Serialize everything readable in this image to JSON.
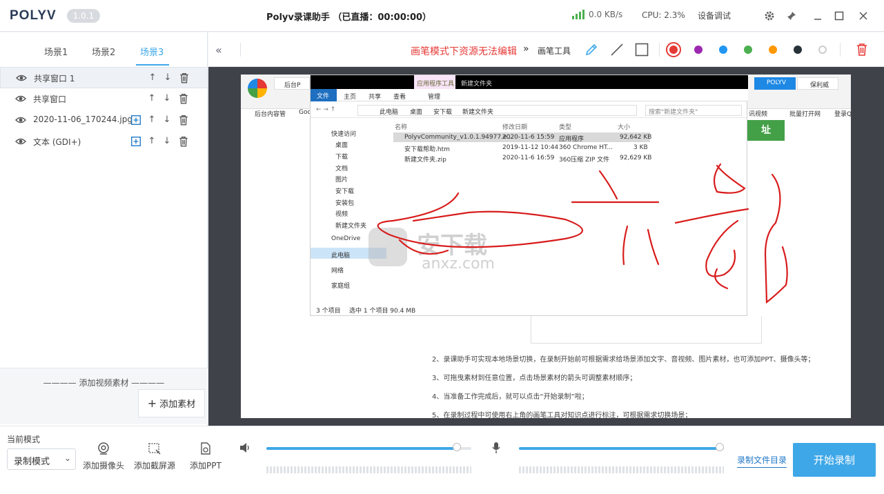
{
  "titlebar": {
    "logo": "POLYV",
    "version": "1.0.1",
    "title": "Polyv录课助手  （已直播：00:00:00）",
    "net_speed": "0.0 KB/s",
    "cpu": "CPU: 2.3%",
    "device_test": "设备调试",
    "icons": [
      "settings-icon",
      "pin-icon",
      "minimize-icon",
      "maximize-icon",
      "close-icon"
    ]
  },
  "scenes": {
    "tabs": [
      "场景1",
      "场景2",
      "场景3"
    ],
    "active_index": 2
  },
  "sources": [
    {
      "label": "共享窗口 1",
      "selected": true,
      "has_add": false
    },
    {
      "label": "共享窗口",
      "selected": false,
      "has_add": false
    },
    {
      "label": "2020-11-06_170244.jpg",
      "selected": false,
      "has_add": true
    },
    {
      "label": "文本 (GDI+)",
      "selected": false,
      "has_add": true
    }
  ],
  "add_panel": {
    "video_label": "———— 添加视频素材 ————",
    "add_material": "添加素材"
  },
  "toolbar": {
    "warning": "画笔模式下资源无法编辑",
    "pen_tools_label": "画笔工具",
    "colors": [
      "#e53935",
      "#9c27b0",
      "#2196f3",
      "#4caf50",
      "#ff9800",
      "#263238",
      "#ffffff"
    ],
    "selected_color": "#e53935"
  },
  "screen": {
    "explorer": {
      "ribbon_tabs": [
        "文件",
        "主页",
        "共享",
        "查看",
        "管理"
      ],
      "context_tab": "应用程序工具",
      "window_title": "新建文件夹",
      "breadcrumb": [
        "此电脑",
        "桌面",
        "安下载",
        "新建文件夹"
      ],
      "search_placeholder": "搜索\"新建文件夹\"",
      "nav": [
        "快速访问",
        "桌面",
        "下载",
        "文档",
        "图片",
        "安下载",
        "安装包",
        "视频",
        "新建文件夹",
        "OneDrive",
        "此电脑",
        "网络",
        "家庭组"
      ],
      "columns": [
        "名称",
        "修改日期",
        "类型",
        "大小"
      ],
      "files": [
        {
          "name": "PolyvCommunity_v1.0.1.94977.e...",
          "date": "2020-11-6 15:59",
          "type": "应用程序",
          "size": "92,642 KB"
        },
        {
          "name": "安下载帮助.htm",
          "date": "2019-11-12 10:44",
          "type": "360 Chrome HT...",
          "size": "3 KB"
        },
        {
          "name": "新建文件夹.zip",
          "date": "2020-11-6 16:59",
          "type": "360压缩 ZIP 文件",
          "size": "92,629 KB"
        }
      ],
      "status_items": "3 个项目",
      "status_selected": "选中 1 个项目  90.4 MB"
    },
    "browser": {
      "tabs_left": [
        "后台P"
      ],
      "tabs_right": [
        "POLYV",
        "保利威"
      ],
      "bookmarks_left": [
        "后台内容管",
        "Goo"
      ],
      "bookmarks_right": [
        "讯视频",
        "批量打开网",
        "登录Q"
      ],
      "green_badge": "址"
    },
    "doc_lines": [
      "2、录课助手可实现本地场景切换，在录制开始前可根据需求给场景添加文字、音视频、图片素材，也可添加PPT、摄像头等；",
      "3、可拖曳素材到任意位置，点击场景素材的箭头可调整素材顺序；",
      "4、当准备工作完成后，就可以点击“开始录制”啦；",
      "5、在录制过程中可使用右上角的画笔工具对知识点进行标注，可根据需求切换场景；"
    ],
    "watermark": "安下载",
    "watermark_url": "anxz.com"
  },
  "bottom": {
    "mode_label": "当前模式",
    "mode_value": "录制模式",
    "add_camera": "添加摄像头",
    "add_screen": "添加截屏源",
    "add_ppt": "添加PPT",
    "speaker_volume": 0.93,
    "mic_volume": 0.98,
    "record_dir": "录制文件目录",
    "start": "开始录制"
  }
}
